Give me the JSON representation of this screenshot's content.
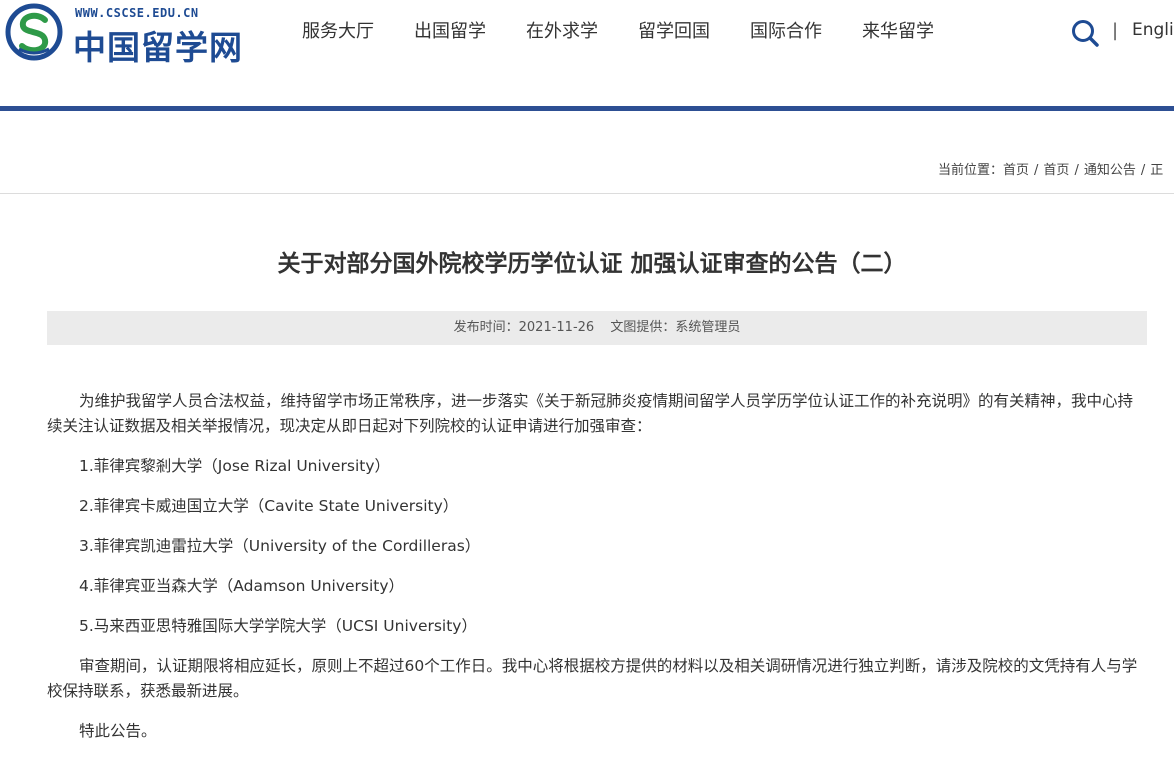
{
  "logo": {
    "url": "WWW.CSCSE.EDU.CN",
    "name": "中国留学网",
    "brand_color": "#1e4b93",
    "accent_color": "#2e9a48"
  },
  "nav": {
    "items": [
      {
        "label": "服务大厅"
      },
      {
        "label": "出国留学"
      },
      {
        "label": "在外求学"
      },
      {
        "label": "留学回国"
      },
      {
        "label": "国际合作"
      },
      {
        "label": "来华留学"
      }
    ],
    "divider": "|",
    "language": "English"
  },
  "breadcrumb": {
    "prefix": "当前位置：",
    "items": [
      "首页",
      "首页",
      "通知公告",
      "正"
    ],
    "separator": "/"
  },
  "article": {
    "title": "关于对部分国外院校学历学位认证 加强认证审查的公告（二）",
    "published_label": "发布时间：",
    "published_date": "2021-11-26",
    "provider_label": "文图提供：",
    "provider": "系统管理员",
    "intro": "为维护我留学人员合法权益，维持留学市场正常秩序，进一步落实《关于新冠肺炎疫情期间留学人员学历学位认证工作的补充说明》的有关精神，我中心持续关注认证数据及相关举报情况，现决定从即日起对下列院校的认证申请进行加强审查：",
    "schools": [
      "1.菲律宾黎剎大学（Jose Rizal University）",
      "2.菲律宾卡威迪国立大学（Cavite State University）",
      "3.菲律宾凯迪雷拉大学（University of the Cordilleras）",
      "4.菲律宾亚当森大学（Adamson University）",
      "5.马来西亚思特雅国际大学学院大学（UCSI University）"
    ],
    "review_text": "审查期间，认证期限将相应延长，原则上不超过60个工作日。我中心将根据校方提供的材料以及相关调研情况进行独立判断，请涉及院校的文凭持有人与学校保持联系，获悉最新进展。",
    "closing": "特此公告。"
  },
  "colors": {
    "header_bar": "#2d4f93",
    "meta_background": "#ebebeb",
    "search_icon": "#1e4b93"
  }
}
